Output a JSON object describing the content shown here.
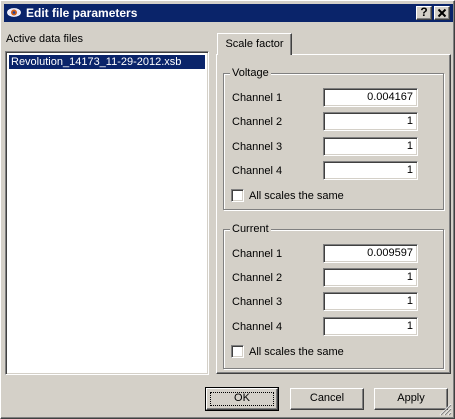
{
  "window": {
    "title": "Edit file parameters",
    "help_label": "?",
    "close_label": "✕"
  },
  "files": {
    "label": "Active data files",
    "items": [
      "Revolution_14173_11-29-2012.xsb"
    ]
  },
  "tabs": [
    {
      "label": "Scale factor"
    }
  ],
  "voltage": {
    "title": "Voltage",
    "channels": [
      {
        "label": "Channel 1",
        "value": "0.004167"
      },
      {
        "label": "Channel 2",
        "value": "1"
      },
      {
        "label": "Channel 3",
        "value": "1"
      },
      {
        "label": "Channel 4",
        "value": "1"
      }
    ],
    "same_label": "All scales the same",
    "same_checked": false
  },
  "current": {
    "title": "Current",
    "channels": [
      {
        "label": "Channel 1",
        "value": "0.009597"
      },
      {
        "label": "Channel 2",
        "value": "1"
      },
      {
        "label": "Channel 3",
        "value": "1"
      },
      {
        "label": "Channel 4",
        "value": "1"
      }
    ],
    "same_label": "All scales the same",
    "same_checked": false
  },
  "buttons": {
    "ok": "OK",
    "cancel": "Cancel",
    "apply": "Apply"
  },
  "colors": {
    "titlebar": "#0a246a",
    "selection": "#0a246a",
    "face": "#d4d0c8"
  },
  "icons": {
    "app": "eye-icon",
    "grip": "resize-grip-icon"
  }
}
